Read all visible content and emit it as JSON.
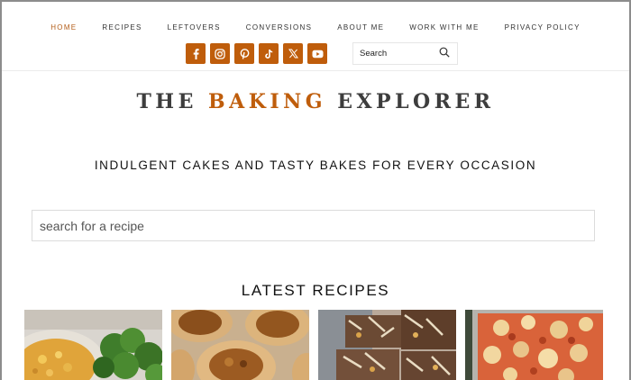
{
  "nav": {
    "items": [
      {
        "label": "HOME",
        "active": true
      },
      {
        "label": "RECIPES"
      },
      {
        "label": "LEFTOVERS"
      },
      {
        "label": "CONVERSIONS"
      },
      {
        "label": "ABOUT ME"
      },
      {
        "label": "WORK WITH ME"
      },
      {
        "label": "PRIVACY POLICY"
      }
    ]
  },
  "social": {
    "icons": [
      "facebook-icon",
      "instagram-icon",
      "pinterest-icon",
      "tiktok-icon",
      "x-icon",
      "youtube-icon"
    ],
    "color": "#bf5d0b"
  },
  "header_search": {
    "placeholder": "Search"
  },
  "logo": {
    "part1": "THE",
    "part2": "BAKING",
    "part3": "EXPLORER",
    "accent_color": "#bf5d0b"
  },
  "tagline": "INDULGENT CAKES AND TASTY BAKES FOR EVERY OCCASION",
  "recipe_search": {
    "placeholder": "search for a recipe"
  },
  "latest": {
    "title": "LATEST RECIPES",
    "cards": [
      {
        "image": "mac-and-cheese-broccoli-photo"
      },
      {
        "image": "pecan-tassies-photo"
      },
      {
        "image": "rocky-road-bars-photo"
      },
      {
        "image": "pizza-bake-photo"
      }
    ]
  }
}
